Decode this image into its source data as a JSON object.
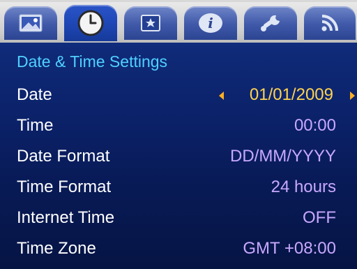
{
  "tabs": [
    {
      "icon": "picture-icon"
    },
    {
      "icon": "clock-icon",
      "active": true
    },
    {
      "icon": "star-frame-icon"
    },
    {
      "icon": "info-icon"
    },
    {
      "icon": "wrench-icon"
    },
    {
      "icon": "rss-icon"
    }
  ],
  "section_title": "Date & Time Settings",
  "settings": [
    {
      "label": "Date",
      "value": "01/01/2009"
    },
    {
      "label": "Time",
      "value": "00:00"
    },
    {
      "label": "Date Format",
      "value": "DD/MM/YYYY"
    },
    {
      "label": "Time Format",
      "value": "24 hours"
    },
    {
      "label": "Internet Time",
      "value": "OFF"
    },
    {
      "label": "Time Zone",
      "value": "GMT +08:00"
    }
  ],
  "colors": {
    "title": "#4fd0ff",
    "label": "#ffffff",
    "value": "#c8a8ff",
    "selected_value": "#ffd34f",
    "arrow": "#ffb020"
  }
}
